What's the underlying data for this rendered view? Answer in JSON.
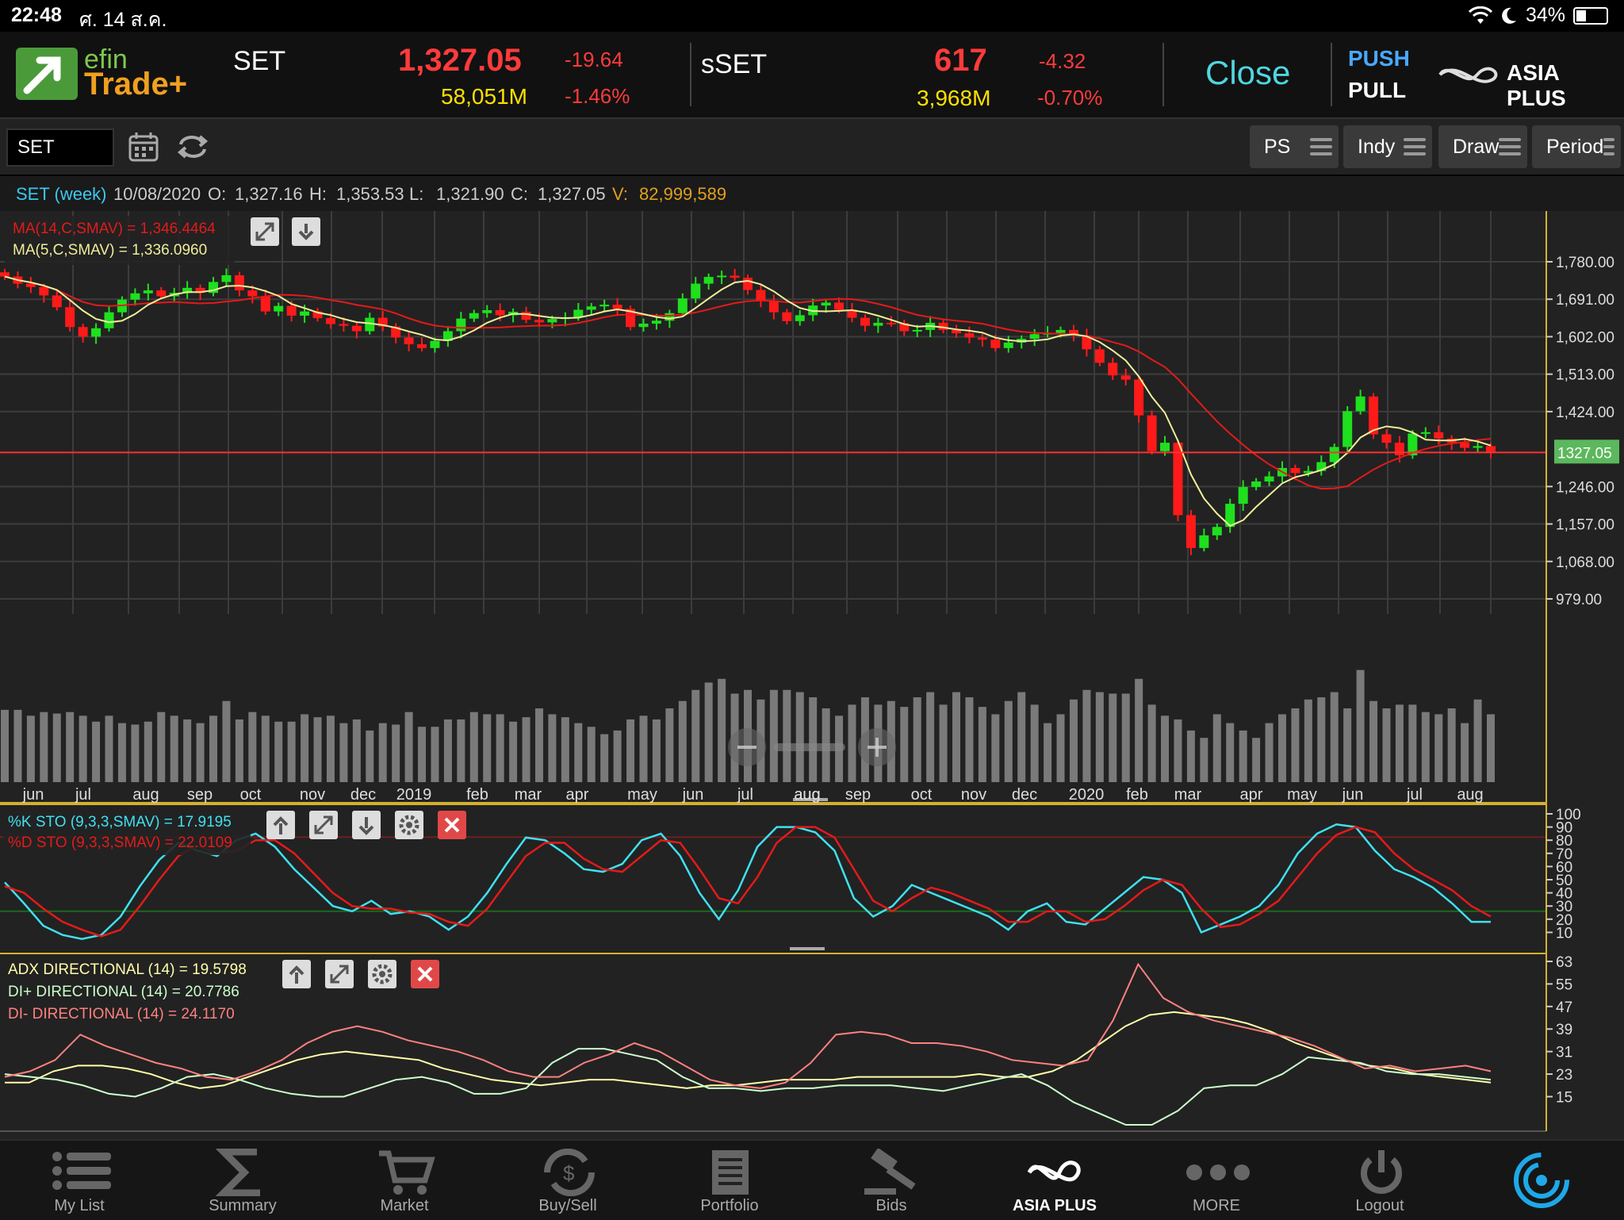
{
  "status_bar": {
    "time": "22:48",
    "date": "ศ. 14 ส.ค.",
    "battery": "34%",
    "battery_level": 0.34
  },
  "app": {
    "logo_top": "efin",
    "logo_bottom": "Trade+"
  },
  "indices": [
    {
      "name": "SET",
      "value": "1,327.05",
      "change": "-19.64",
      "volume": "58,051M",
      "change_pct": "-1.46%"
    },
    {
      "name": "sSET",
      "value": "617",
      "change": "-4.32",
      "volume": "3,968M",
      "change_pct": "-0.70%"
    }
  ],
  "market_status": "Close",
  "push_pull": {
    "push": "PUSH",
    "pull": "PULL"
  },
  "broker_logo": "ASIA PLUS",
  "toolbar": {
    "symbol": "SET",
    "buttons": [
      "PS",
      "Indy",
      "Draw",
      "Period"
    ]
  },
  "info": {
    "symbol": "SET (week)",
    "date": "10/08/2020",
    "o_label": "O:",
    "open": "1,327.16",
    "h_label": "H:",
    "high": "1,353.53",
    "l_label": "L:",
    "low": "1,321.90",
    "c_label": "C:",
    "close": "1,327.05",
    "v_label": "V:",
    "volume": "82,999,589"
  },
  "colors": {
    "up": "#1ee01e",
    "down": "#ff1a1a",
    "ma14": "#e41a1a",
    "ma5": "#eeee99",
    "stoK": "#40e0f0",
    "stoD": "#e41a1a",
    "adx": "#ffffaa",
    "diplus": "#ccffcc",
    "diminus": "#ff8080"
  },
  "chart_data": [
    {
      "type": "candlestick",
      "title": "SET (week)",
      "legend": [
        "MA(14,C,SMAV) = 1,346.4464",
        "MA(5,C,SMAV) = 1,336.0960"
      ],
      "ylim": [
        979,
        1800
      ],
      "y_ticks": [
        "1,780.00",
        "1,691.00",
        "1,602.00",
        "1,513.00",
        "1,424.00",
        "1,246.00",
        "1,157.00",
        "1,068.00",
        "979.00"
      ],
      "last_price_label": "1327.05",
      "last_price": 1327.05,
      "x_month_labels": [
        "jun",
        "jul",
        "aug",
        "sep",
        "oct",
        "nov",
        "dec",
        "2019",
        "feb",
        "mar",
        "apr",
        "may",
        "jun",
        "jul",
        "aug",
        "aug",
        "sep",
        "oct",
        "nov",
        "dec",
        "2020",
        "feb",
        "mar",
        "apr",
        "may",
        "jun",
        "jul",
        "aug"
      ],
      "close": [
        1745,
        1728,
        1720,
        1700,
        1672,
        1625,
        1602,
        1622,
        1660,
        1690,
        1705,
        1712,
        1698,
        1706,
        1718,
        1706,
        1732,
        1748,
        1712,
        1698,
        1662,
        1675,
        1652,
        1662,
        1646,
        1632,
        1628,
        1615,
        1647,
        1626,
        1600,
        1584,
        1575,
        1592,
        1615,
        1645,
        1658,
        1665,
        1653,
        1661,
        1642,
        1636,
        1644,
        1648,
        1666,
        1674,
        1678,
        1668,
        1625,
        1633,
        1640,
        1658,
        1693,
        1728,
        1744,
        1747,
        1742,
        1713,
        1686,
        1660,
        1639,
        1653,
        1676,
        1683,
        1666,
        1647,
        1628,
        1635,
        1634,
        1615,
        1618,
        1635,
        1618,
        1610,
        1600,
        1595,
        1575,
        1588,
        1597,
        1608,
        1611,
        1618,
        1605,
        1572,
        1540,
        1510,
        1500,
        1415,
        1330,
        1350,
        1178,
        1100,
        1130,
        1150,
        1205,
        1245,
        1258,
        1270,
        1290,
        1278,
        1283,
        1304,
        1340,
        1425,
        1460,
        1370,
        1350,
        1320,
        1372,
        1375,
        1360,
        1350,
        1338,
        1342,
        1327
      ],
      "volume_M": [
        98,
        98,
        90,
        95,
        93,
        95,
        90,
        82,
        90,
        80,
        78,
        82,
        95,
        90,
        85,
        80,
        90,
        110,
        85,
        95,
        90,
        82,
        82,
        92,
        88,
        90,
        80,
        85,
        70,
        80,
        78,
        95,
        75,
        75,
        85,
        85,
        95,
        92,
        92,
        82,
        88,
        100,
        92,
        88,
        80,
        75,
        65,
        70,
        85,
        90,
        85,
        100,
        110,
        125,
        135,
        140,
        120,
        125,
        112,
        125,
        125,
        122,
        115,
        100,
        90,
        105,
        115,
        105,
        110,
        102,
        115,
        122,
        105,
        122,
        115,
        102,
        92,
        110,
        122,
        105,
        80,
        92,
        112,
        125,
        122,
        120,
        120,
        140,
        105,
        90,
        85,
        70,
        60,
        92,
        80,
        70,
        60,
        80,
        92,
        100,
        112,
        115,
        122,
        100,
        152,
        110,
        100,
        105,
        105,
        95,
        92,
        100,
        80,
        112,
        92
      ]
    },
    {
      "type": "line",
      "title": "STO",
      "legend": [
        "%K STO (9,3,3,SMAV) = 17.9195",
        "%D STO (9,3,3,SMAV) = 22.0109"
      ],
      "ylim": [
        0,
        100
      ],
      "y_ticks": [
        "100",
        "90",
        "80",
        "70",
        "60",
        "50",
        "40",
        "30",
        "20",
        "10"
      ],
      "series": [
        {
          "name": "%K STO (9,3,3,SMAV)",
          "values": [
            48,
            32,
            15,
            8,
            5,
            8,
            22,
            45,
            65,
            78,
            72,
            68,
            80,
            85,
            75,
            58,
            44,
            30,
            26,
            34,
            24,
            26,
            22,
            12,
            22,
            40,
            62,
            82,
            80,
            70,
            58,
            56,
            62,
            80,
            85,
            68,
            40,
            20,
            42,
            75,
            90,
            90,
            86,
            72,
            36,
            22,
            30,
            46,
            40,
            34,
            28,
            22,
            12,
            26,
            32,
            18,
            16,
            28,
            40,
            52,
            50,
            40,
            10,
            16,
            22,
            30,
            46,
            70,
            85,
            92,
            90,
            72,
            58,
            52,
            44,
            32,
            18,
            18
          ]
        },
        {
          "name": "%D STO (9,3,3,SMAV)",
          "values": [
            45,
            40,
            28,
            18,
            12,
            7,
            12,
            30,
            50,
            68,
            76,
            70,
            72,
            80,
            80,
            70,
            55,
            40,
            30,
            28,
            28,
            25,
            24,
            18,
            15,
            28,
            48,
            68,
            78,
            78,
            66,
            58,
            56,
            68,
            80,
            78,
            58,
            36,
            32,
            52,
            78,
            90,
            90,
            82,
            58,
            34,
            26,
            36,
            44,
            40,
            34,
            28,
            18,
            18,
            26,
            26,
            18,
            20,
            30,
            42,
            50,
            46,
            28,
            14,
            16,
            24,
            34,
            52,
            70,
            84,
            90,
            86,
            70,
            58,
            50,
            42,
            30,
            22
          ]
        }
      ]
    },
    {
      "type": "line",
      "title": "ADX DIRECTIONAL",
      "legend": [
        "ADX DIRECTIONAL (14) = 19.5798",
        "DI+ DIRECTIONAL (14) = 20.7786",
        "DI- DIRECTIONAL (14) = 24.1170"
      ],
      "ylim": [
        5,
        63
      ],
      "y_ticks": [
        "63",
        "55",
        "47",
        "39",
        "31",
        "23",
        "15"
      ],
      "series": [
        {
          "name": "ADX DIRECTIONAL (14)",
          "values": [
            20,
            20,
            24,
            26,
            26,
            25,
            23,
            20,
            18,
            19,
            22,
            25,
            28,
            30,
            31,
            30,
            29,
            28,
            25,
            23,
            21,
            20,
            19,
            20,
            21,
            21,
            20,
            19,
            18,
            19,
            19,
            20,
            21,
            21,
            21,
            22,
            22,
            22,
            22,
            22,
            23,
            22,
            22,
            24,
            28,
            34,
            40,
            44,
            45,
            44,
            43,
            41,
            38,
            34,
            31,
            28,
            26,
            25,
            23,
            22,
            21,
            20
          ]
        },
        {
          "name": "DI+ DIRECTIONAL (14)",
          "values": [
            23,
            22,
            21,
            19,
            16,
            15,
            18,
            22,
            23,
            21,
            18,
            16,
            15,
            15,
            18,
            21,
            22,
            20,
            16,
            16,
            18,
            27,
            32,
            32,
            30,
            28,
            22,
            18,
            18,
            17,
            18,
            18,
            19,
            19,
            19,
            18,
            17,
            19,
            21,
            23,
            19,
            13,
            9,
            5,
            5,
            10,
            18,
            19,
            19,
            23,
            29,
            28,
            27,
            24,
            23,
            23,
            22,
            21
          ]
        },
        {
          "name": "DI- DIRECTIONAL (14)",
          "values": [
            22,
            24,
            28,
            37,
            33,
            30,
            27,
            25,
            22,
            21,
            24,
            28,
            34,
            38,
            40,
            38,
            35,
            33,
            31,
            28,
            24,
            22,
            22,
            27,
            30,
            34,
            31,
            26,
            21,
            19,
            18,
            20,
            27,
            37,
            38,
            37,
            34,
            34,
            33,
            31,
            28,
            27,
            26,
            28,
            42,
            62,
            50,
            45,
            42,
            40,
            38,
            36,
            33,
            29,
            25,
            26,
            24,
            25,
            26,
            24
          ]
        }
      ]
    }
  ],
  "nav": [
    "My List",
    "Summary",
    "Market",
    "Buy/Sell",
    "Portfolio",
    "Bids",
    "ASIA PLUS",
    "MORE",
    "Logout"
  ]
}
